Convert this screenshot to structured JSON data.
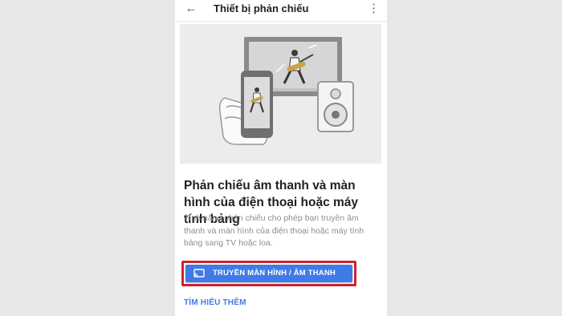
{
  "appbar": {
    "title": "Thiết bị phản chiếu",
    "back_icon": "arrow-back-icon",
    "menu_icon": "more-vert-icon"
  },
  "hero": {
    "illustration": "phone-tv-speaker-guitarist-illustration"
  },
  "content": {
    "headline": "Phản chiếu âm thanh và màn hình của điện thoại hoặc máy tính bảng",
    "description": "Tính năng phản chiếu cho phép bạn truyền âm thanh và màn hình của điện thoại hoặc máy tính bảng sang TV hoặc loa."
  },
  "cast_button": {
    "label": "TRUYỀN MÀN HÌNH / ÂM THANH",
    "icon": "cast-icon",
    "color": "#3f7be8",
    "highlight_color": "#d0222b"
  },
  "learn_more": {
    "label": "TÌM HIỂU THÊM"
  }
}
